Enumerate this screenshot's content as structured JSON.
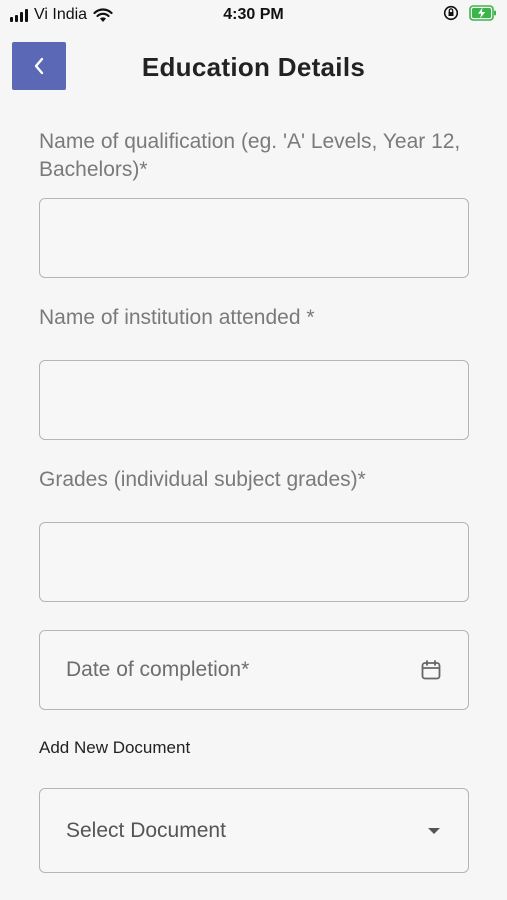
{
  "status_bar": {
    "carrier": "Vi India",
    "time": "4:30 PM",
    "icons": [
      "signal-icon",
      "wifi-icon",
      "orientation-lock-icon",
      "battery-charging-icon"
    ],
    "battery_color": "#3bb54a"
  },
  "header": {
    "title": "Education Details",
    "back_icon": "chevron-left-icon",
    "back_button_color": "#5a68b6"
  },
  "form": {
    "qualification": {
      "label": "Name of qualification (eg. 'A' Levels, Year 12, Bachelors)*",
      "value": ""
    },
    "institution": {
      "label": "Name of institution attended *",
      "value": ""
    },
    "grades": {
      "label": "Grades (individual subject grades)*",
      "value": ""
    },
    "completion_date": {
      "placeholder": "Date of completion*",
      "icon": "calendar-icon"
    },
    "add_document": {
      "label": "Add New Document"
    },
    "document_select": {
      "selected": "Select Document",
      "icon": "dropdown-arrow-icon"
    }
  }
}
